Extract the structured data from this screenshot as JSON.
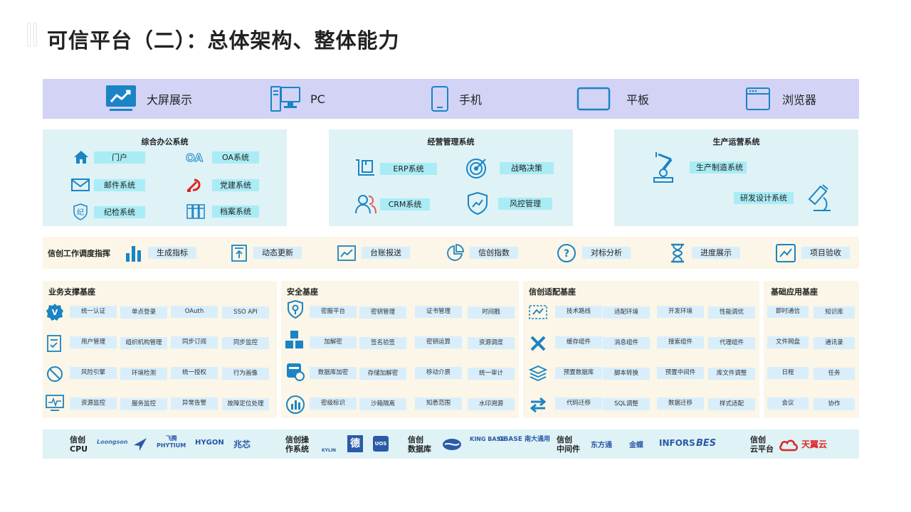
{
  "title": "可信平台（二）：总体架构、整体能力",
  "devices": [
    {
      "icon": "trend-screen-icon",
      "label": "大屏展示"
    },
    {
      "icon": "desktop-pc-icon",
      "label": "PC"
    },
    {
      "icon": "mobile-phone-icon",
      "label": "手机"
    },
    {
      "icon": "tablet-icon",
      "label": "平板"
    },
    {
      "icon": "browser-window-icon",
      "label": "浏览器"
    }
  ],
  "office": {
    "title": "综合办公系统",
    "items": [
      "门户",
      "邮件系统",
      "纪检系统",
      "OA系统",
      "党建系统",
      "档案系统"
    ]
  },
  "business": {
    "title": "经营管理系统",
    "items": [
      "ERP系统",
      "CRM系统",
      "战略决策",
      "风控管理"
    ]
  },
  "production": {
    "title": "生产运营系统",
    "items": [
      "生产制造系统",
      "研发设计系统"
    ]
  },
  "dispatch": {
    "head": "信创工作调度指挥",
    "items": [
      "生成指标",
      "动态更新",
      "台账报送",
      "信创指数",
      "对标分析",
      "进度展示",
      "项目验收"
    ]
  },
  "biz_base": {
    "title": "业务支撑基座",
    "rows": [
      [
        "统一认证",
        "单点登录",
        "OAuth",
        "SSO API"
      ],
      [
        "用户管理",
        "组织机构管理",
        "同步订阅",
        "同步监控"
      ],
      [
        "风险引擎",
        "环境检测",
        "统一授权",
        "行为画像"
      ],
      [
        "资源监控",
        "服务监控",
        "异常告警",
        "故障定位处理"
      ]
    ]
  },
  "sec_base": {
    "title": "安全基座",
    "rows": [
      [
        "密服平台",
        "密钥管理",
        "证书管理",
        "时间戳"
      ],
      [
        "加解密",
        "签名验签",
        "密钥运算",
        "资源调度"
      ],
      [
        "数据库加密",
        "存储加解密",
        "移动介质",
        "统一审计"
      ],
      [
        "密级标识",
        "沙箱隔离",
        "知悉范围",
        "水印溯源"
      ]
    ]
  },
  "adapt_base": {
    "title": "信创适配基座",
    "rows": [
      [
        "技术路线",
        "适配环境",
        "开发环境",
        "性能调优"
      ],
      [
        "缓存组件",
        "消息组件",
        "搜索组件",
        "代理组件"
      ],
      [
        "预置数据库",
        "脚本转换",
        "预置中间件",
        "库文件调整"
      ],
      [
        "代码迁移",
        "SQL调整",
        "数据迁移",
        "样式适配"
      ]
    ]
  },
  "app_base": {
    "title": "基础应用基座",
    "rows": [
      [
        "即时通信",
        "知识库"
      ],
      [
        "文件网盘",
        "通讯录"
      ],
      [
        "日程",
        "任务"
      ],
      [
        "会议",
        "协作"
      ]
    ]
  },
  "ecosystem": {
    "cpu": {
      "label1": "信创",
      "label2": "CPU",
      "logos": [
        "Loongson",
        "PHYTIUM",
        "HYGON",
        "兆芯"
      ],
      "logo_sub": "飞腾"
    },
    "os": {
      "label1": "信创操",
      "label2": "作系统",
      "logos": [
        "KYLIN",
        "德",
        "UOS"
      ]
    },
    "db": {
      "label1": "信创",
      "label2": "数据库",
      "logos": [
        "KING BASE",
        "GBASE 南大通用"
      ]
    },
    "mw": {
      "label1": "信创",
      "label2": "中间件",
      "logos": [
        "东方通",
        "金蝶",
        "INFORS",
        "BES"
      ]
    },
    "cloud": {
      "label1": "信创",
      "label2": "云平台",
      "logos": [
        "天翼云"
      ]
    }
  },
  "colors": {
    "accent": "#1a84c6",
    "device_bar": "#d3d3f6",
    "panel": "#dff2f5",
    "tag": "#a9ecf6",
    "strip": "#fbf6e7",
    "btag": "#d9eefb"
  }
}
